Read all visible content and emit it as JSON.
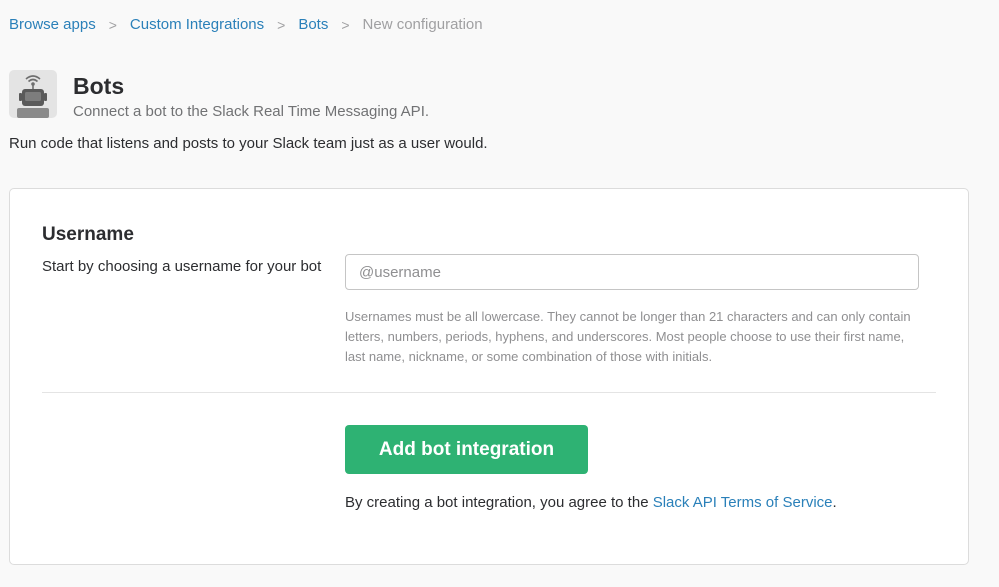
{
  "breadcrumb": {
    "items": [
      "Browse apps",
      "Custom Integrations",
      "Bots"
    ],
    "separator": ">",
    "current": "New configuration"
  },
  "app": {
    "icon": "bot-icon",
    "title": "Bots",
    "subtitle": "Connect a bot to the Slack Real Time Messaging API.",
    "description": "Run code that listens and posts to your Slack team just as a user would."
  },
  "form": {
    "username_title": "Username",
    "username_help": "Start by choosing a username for your bot",
    "username_placeholder": "@username",
    "username_value": "",
    "hint": "Usernames must be all lowercase. They cannot be longer than 21 characters and can only contain letters, numbers, periods, hyphens, and underscores. Most people choose to use their first name, last name, nickname, or some combination of those with initials.",
    "submit_label": "Add bot integration",
    "terms_prefix": "By creating a bot integration, you agree to the ",
    "terms_link": "Slack API Terms of Service",
    "terms_suffix": "."
  },
  "colors": {
    "link": "#2a80b9",
    "primary_button": "#2eb273",
    "muted_text": "#8f8f91",
    "background": "#f9f9f9"
  }
}
